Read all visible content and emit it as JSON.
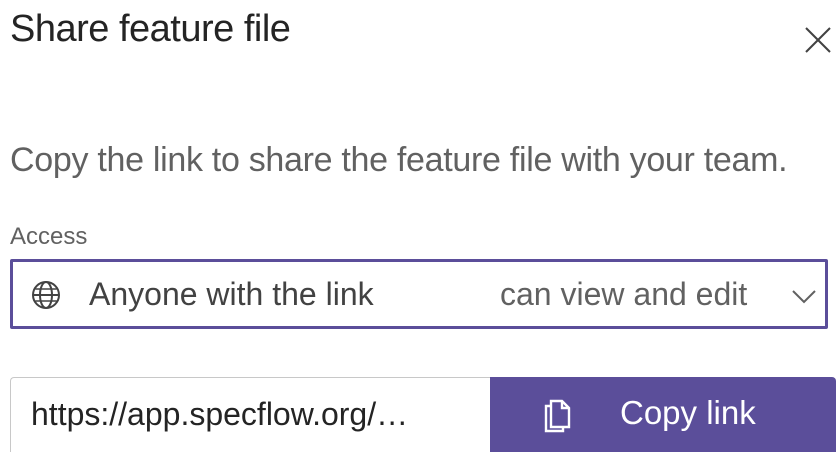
{
  "dialog": {
    "title": "Share feature file",
    "description": "Copy the link to share the feature file with your team.",
    "close_icon": "close-icon"
  },
  "access": {
    "label": "Access",
    "scope": "Anyone with the link",
    "permission": "can view and edit",
    "scope_icon": "globe-icon",
    "dropdown_icon": "chevron-down-icon"
  },
  "share_link": {
    "value": "https://app.specflow.org/…",
    "button_label": "Copy link",
    "button_icon": "copy-icon"
  },
  "colors": {
    "accent": "#5b4e9a",
    "title_text": "#242424",
    "secondary_text": "#616161"
  }
}
